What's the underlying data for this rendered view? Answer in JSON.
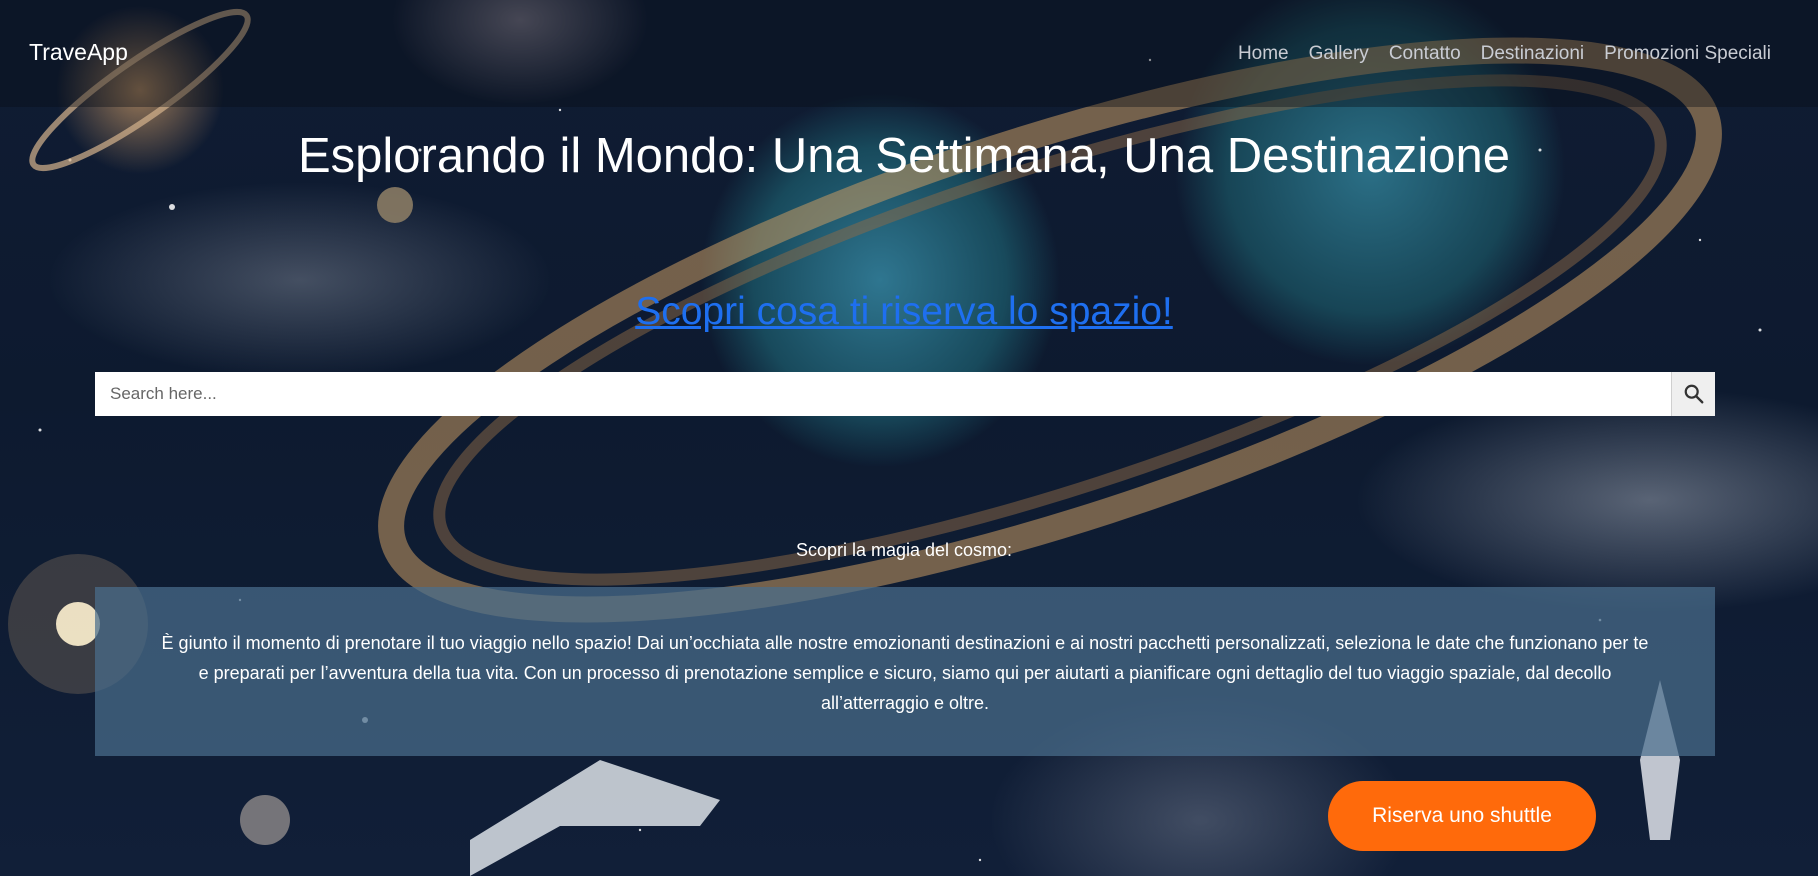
{
  "header": {
    "brand": "TraveApp",
    "nav": [
      {
        "label": "Home"
      },
      {
        "label": "Gallery"
      },
      {
        "label": "Contatto"
      },
      {
        "label": "Destinazioni"
      },
      {
        "label": "Promozioni Speciali"
      }
    ]
  },
  "hero": {
    "title": "Esplorando il Mondo: Una Settimana, Una Destinazione",
    "link_label": "Scopri cosa ti riserva lo spazio!"
  },
  "search": {
    "placeholder": "Search here...",
    "value": "",
    "button_icon": "search-icon"
  },
  "section": {
    "label": "Scopri la magia del cosmo:",
    "body": "È giunto il momento di prenotare il tuo viaggio nello spazio! Dai un’occhiata alle nostre emozionanti destinazioni e ai nostri pacchetti personalizzati, seleziona le date che funzionano per te e preparati per l’avventura della tua vita. Con un processo di prenotazione semplice e sicuro, siamo qui per aiutarti a pianificare ogni dettaglio del tuo viaggio spaziale, dal decollo all’atterraggio e oltre."
  },
  "cta": {
    "label": "Riserva uno shuttle"
  },
  "colors": {
    "accent": "#ff6a0b",
    "link": "#1e6ff0",
    "info_panel": "#496d8c"
  }
}
